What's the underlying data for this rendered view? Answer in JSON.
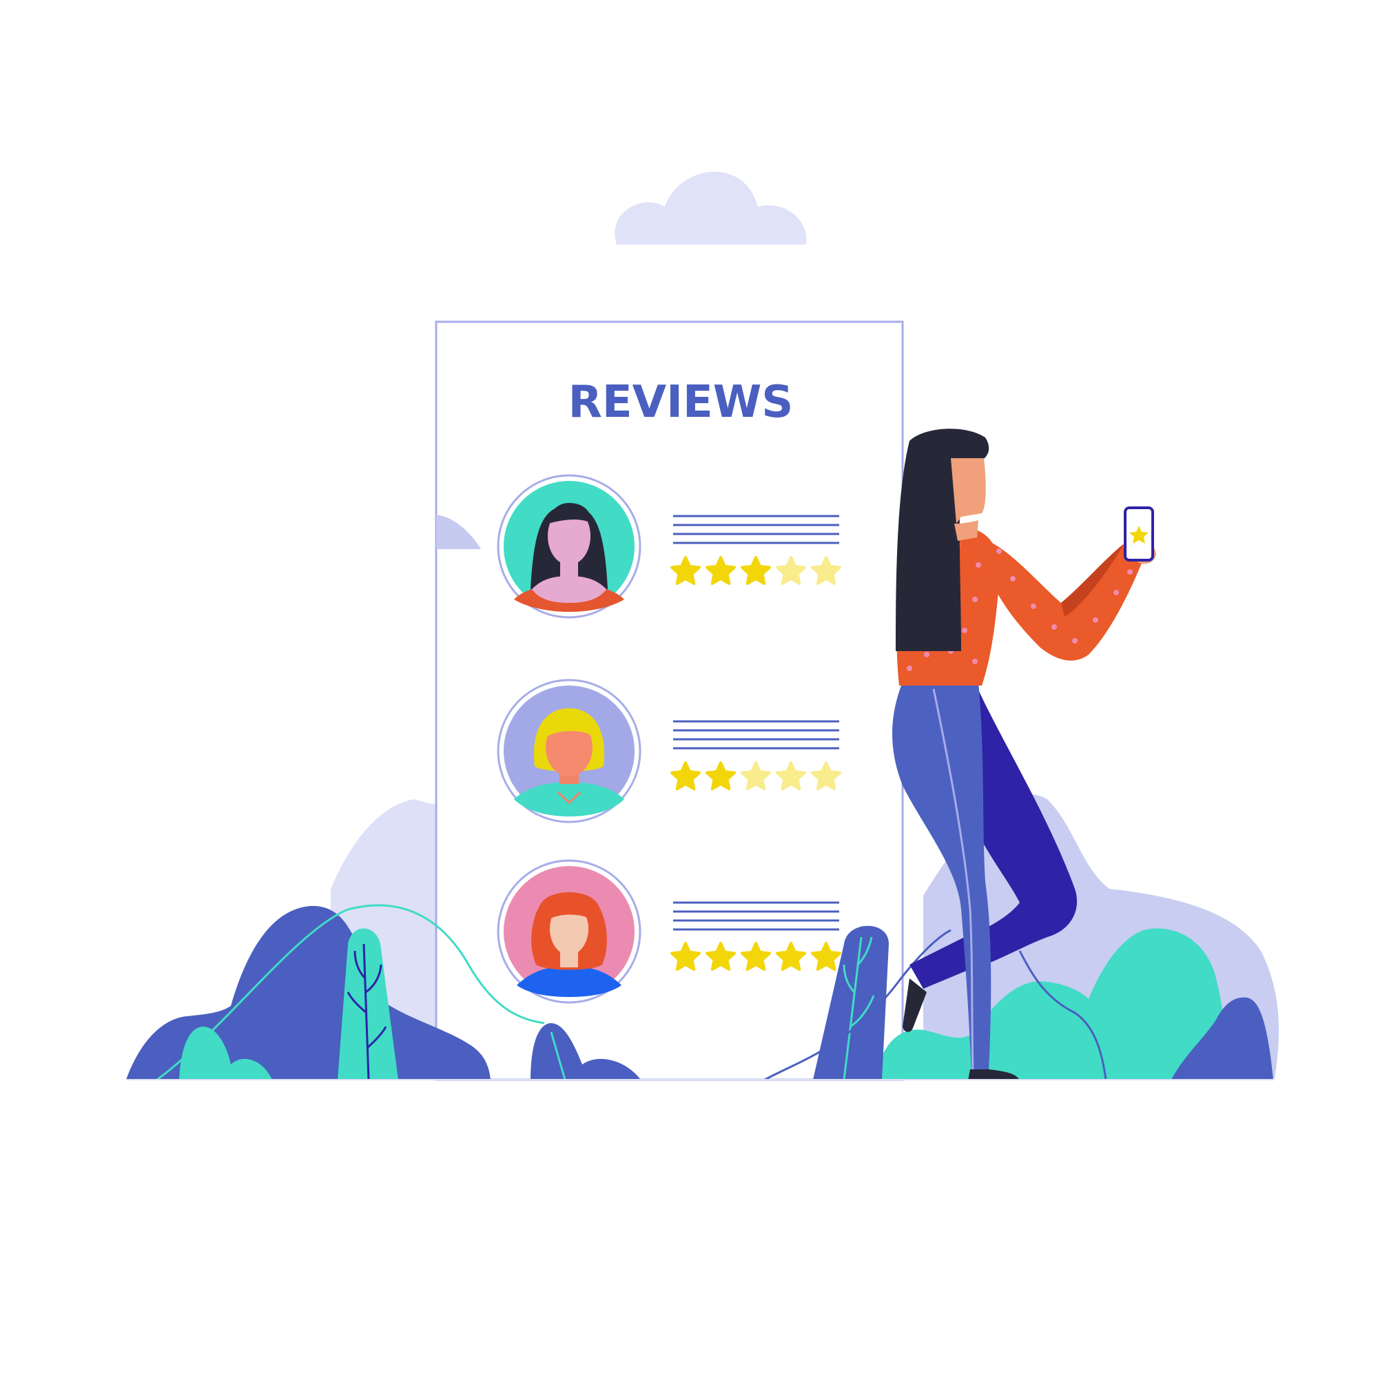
{
  "card": {
    "title": "REVIEWS"
  },
  "reviews": [
    {
      "avatar": "avatar-dark-hair-woman",
      "rating": 3,
      "max_rating": 5
    },
    {
      "avatar": "avatar-blonde-woman",
      "rating": 2,
      "max_rating": 5
    },
    {
      "avatar": "avatar-redhead-woman",
      "rating": 5,
      "max_rating": 5
    }
  ],
  "colors": {
    "brand_blue": "#4a5fbf",
    "teal": "#41dbc6",
    "lavender": "#a7ade8",
    "pale_lavender": "#dde0f7",
    "star_filled": "#f2d60a",
    "star_empty": "#f8ec8d",
    "shirt_orange": "#ea5a2a",
    "pants_blue": "#4d61c1",
    "pants_dark": "#2e22a6",
    "hair_dark": "#262838",
    "skin": "#f0a17b"
  },
  "icons": [
    "cloud-icon",
    "star-icon",
    "smartphone-icon"
  ]
}
